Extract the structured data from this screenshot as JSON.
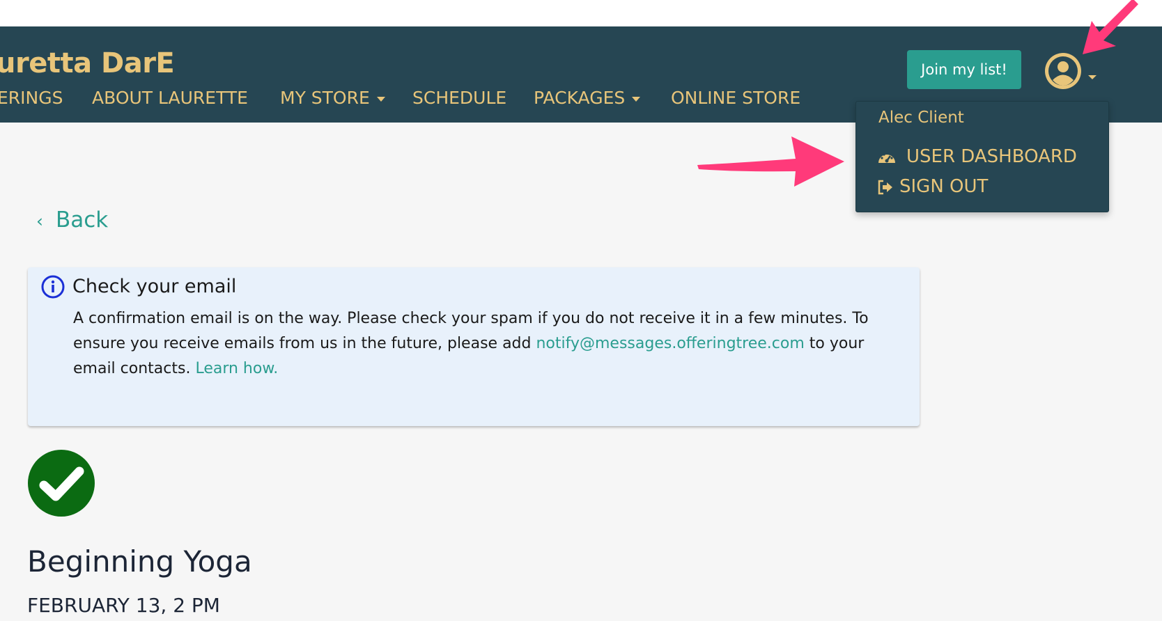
{
  "header": {
    "site_title": "uretta DarE",
    "nav": [
      {
        "label": "ERINGS",
        "dropdown": false
      },
      {
        "label": "ABOUT LAURETTE",
        "dropdown": false
      },
      {
        "label": "MY STORE",
        "dropdown": true
      },
      {
        "label": "SCHEDULE",
        "dropdown": false
      },
      {
        "label": "PACKAGES",
        "dropdown": true
      },
      {
        "label": "ONLINE STORE",
        "dropdown": false
      }
    ],
    "join_button": "Join my list!",
    "avatar_icon": "user-circle-icon"
  },
  "user_menu": {
    "user_name": "Alec Client",
    "items": [
      {
        "label": "USER DASHBOARD",
        "icon": "dashboard-gauge-icon"
      },
      {
        "label": "SIGN OUT",
        "icon": "sign-out-icon"
      }
    ]
  },
  "back_link": "Back",
  "alert": {
    "title": "Check your email",
    "icon": "info-circle-icon",
    "body_part1": "A confirmation email is on the way. Please check your spam if you do not receive it in a few minutes. To ensure you receive emails from us in the future, please add ",
    "email": "notify@messages.offeringtree.com",
    "body_part2": " to your email contacts. ",
    "learn_link": "Learn how."
  },
  "booking": {
    "status_icon": "success-check-icon",
    "title": "Beginning Yoga",
    "date": "FEBRUARY 13, 2 PM"
  },
  "colors": {
    "header_bg": "#264653",
    "accent_gold": "#e8c57a",
    "teal": "#2a9d8f",
    "alert_bg": "#e8f1fb",
    "success_green": "#0b6b12",
    "annotation_pink": "#ff3a7a"
  }
}
